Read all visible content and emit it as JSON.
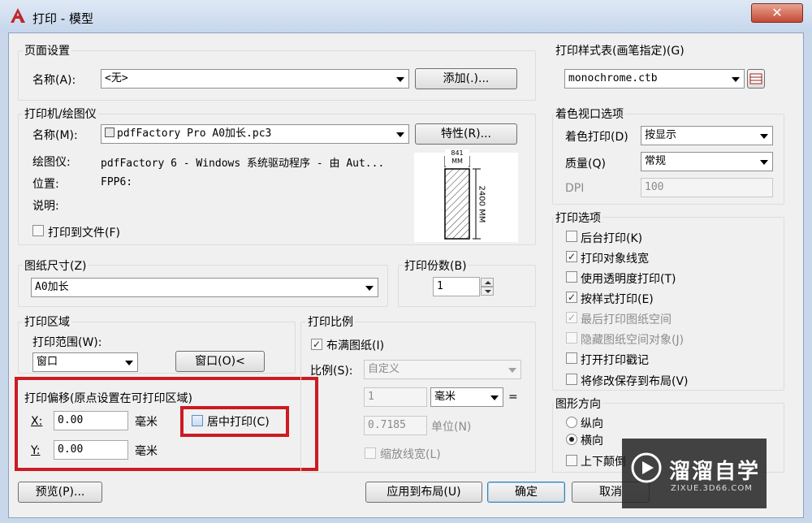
{
  "window": {
    "title": "打印 - 模型",
    "close": "✕"
  },
  "page_setup": {
    "group": "页面设置",
    "name_label": "名称(A):",
    "name_value": "<无>",
    "add_button": "添加(.)..."
  },
  "plotter": {
    "group": "打印机/绘图仪",
    "name_label": "名称(M):",
    "name_value": "pdfFactory Pro A0加长.pc3",
    "properties_button": "特性(R)...",
    "plotter_label": "绘图仪:",
    "plotter_value": "pdfFactory 6 - Windows 系统驱动程序 - 由 Aut...",
    "where_label": "位置:",
    "where_value": "FPP6:",
    "desc_label": "说明:",
    "plot_to_file": "打印到文件(F)",
    "preview_width": "841 MM",
    "preview_height": "2400 MM"
  },
  "paper": {
    "group": "图纸尺寸(Z)",
    "value": "A0加长"
  },
  "copies": {
    "group": "打印份数(B)",
    "value": "1"
  },
  "plot_area": {
    "group": "打印区域",
    "range_label": "打印范围(W):",
    "range_value": "窗口",
    "window_button": "窗口(O)<"
  },
  "plot_offset": {
    "group": "打印偏移(原点设置在可打印区域)",
    "x_label": "X:",
    "x_value": "0.00",
    "x_unit": "毫米",
    "y_label": "Y:",
    "y_value": "0.00",
    "y_unit": "毫米",
    "center_label": "居中打印(C)",
    "center_checked": false
  },
  "plot_scale": {
    "group": "打印比例",
    "fit_label": "布满图纸(I)",
    "fit_checked": true,
    "scale_label": "比例(S):",
    "scale_value": "自定义",
    "value1": "1",
    "unit": "毫米",
    "equals": "=",
    "value2": "0.7185",
    "unit2_label": "单位(N)",
    "lineweights_label": "缩放线宽(L)"
  },
  "plot_style_table": {
    "group": "打印样式表(画笔指定)(G)",
    "value": "monochrome.ctb"
  },
  "shaded_viewport": {
    "group": "着色视口选项",
    "shade_label": "着色打印(D)",
    "shade_value": "按显示",
    "quality_label": "质量(Q)",
    "quality_value": "常规",
    "dpi_label": "DPI",
    "dpi_value": "100"
  },
  "plot_options": {
    "group": "打印选项",
    "items": [
      {
        "label": "后台打印(K)",
        "checked": false,
        "disabled": false
      },
      {
        "label": "打印对象线宽",
        "checked": true,
        "disabled": false
      },
      {
        "label": "使用透明度打印(T)",
        "checked": false,
        "disabled": false
      },
      {
        "label": "按样式打印(E)",
        "checked": true,
        "disabled": false
      },
      {
        "label": "最后打印图纸空间",
        "checked": true,
        "disabled": true
      },
      {
        "label": "隐藏图纸空间对象(J)",
        "checked": false,
        "disabled": true
      },
      {
        "label": "打开打印戳记",
        "checked": false,
        "disabled": false
      },
      {
        "label": "将修改保存到布局(V)",
        "checked": false,
        "disabled": false
      }
    ]
  },
  "orientation": {
    "group": "图形方向",
    "portrait": "纵向",
    "landscape": "横向",
    "upside_down": "上下颠倒"
  },
  "footer": {
    "preview": "预览(P)...",
    "apply": "应用到布局(U)",
    "ok": "确定",
    "cancel": "取消"
  },
  "watermark": {
    "name": "溜溜自学",
    "url": "ZIXUE.3D66.COM"
  }
}
